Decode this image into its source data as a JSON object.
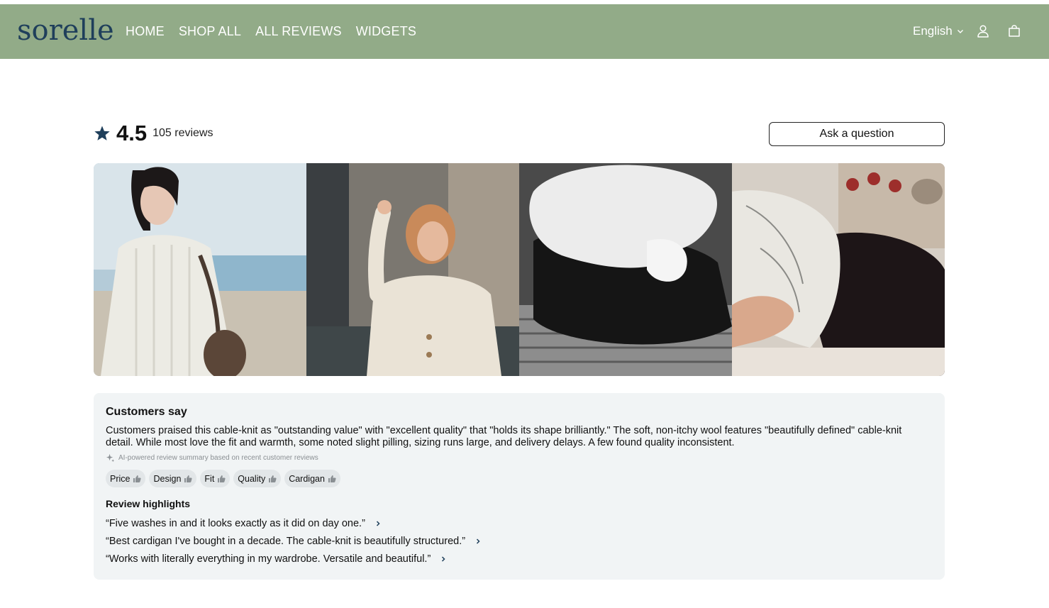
{
  "header": {
    "logo": "sorelle",
    "nav": [
      "HOME",
      "SHOP ALL",
      "ALL REVIEWS",
      "WIDGETS"
    ],
    "language": "English",
    "icons": [
      "account-icon",
      "cart-icon"
    ]
  },
  "reviews": {
    "rating": "4.5",
    "count_label": "105 reviews",
    "ask_button": "Ask a question"
  },
  "gallery": {
    "photos": [
      "customer-photo-1",
      "customer-photo-2",
      "customer-photo-3",
      "customer-photo-4"
    ]
  },
  "summary": {
    "title": "Customers say",
    "text": "Customers praised this cable-knit as \"outstanding value\" with \"excellent quality\" that \"holds its shape brilliantly.\" The soft, non-itchy wool features \"beautifully defined\" cable-knit detail. While most love the fit and warmth, some noted slight pilling, sizing runs large, and delivery delays. A few found quality inconsistent.",
    "ai_note": "AI-powered review summary based on recent customer reviews",
    "chips": [
      "Price",
      "Design",
      "Fit",
      "Quality",
      "Cardigan"
    ],
    "highlights_title": "Review highlights",
    "highlights": [
      "“Five washes in and it looks exactly as it did on day one.”",
      "“Best cardigan I've bought in a decade. The cable-knit is beautifully structured.”",
      "“Works with literally everything in my wardrobe. Versatile and beautiful.”"
    ]
  },
  "colors": {
    "header_bg": "#92ab88",
    "logo": "#1f3f5b",
    "star": "#1f3f5b",
    "summary_bg": "#f1f4f5"
  }
}
